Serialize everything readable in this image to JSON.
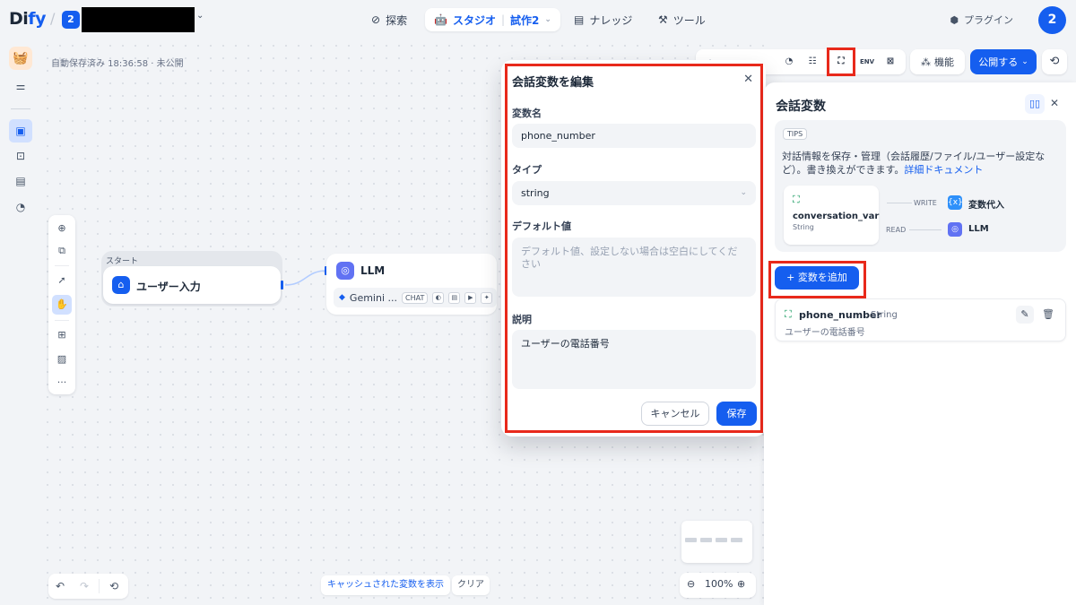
{
  "topbar": {
    "logo_pre": "Di",
    "logo_accent": "fy",
    "workspace_initial": "2",
    "nav": [
      {
        "icon": "compass-icon",
        "label": "探索"
      },
      {
        "icon": "robot-icon",
        "label": "スタジオ",
        "sub": "試作2"
      },
      {
        "icon": "book-icon",
        "label": "ナレッジ"
      },
      {
        "icon": "tools-icon",
        "label": "ツール"
      }
    ],
    "plugin_label": "プラグイン",
    "avatar_initial": "2"
  },
  "canvas": {
    "autosave": "自動保存済み 18:36:58 · 未公開",
    "start_group_label": "スタート",
    "start_node_title": "ユーザー入力",
    "llm_node_title": "LLM",
    "llm_model": "Gemini ...",
    "llm_mode": "CHAT",
    "cache_button": "キャッシュされた変数を表示",
    "clear_button": "クリア",
    "zoom_level": "100%"
  },
  "toolbar": {
    "env_label": "ENV",
    "feature_label": "機能",
    "publish_label": "公開する"
  },
  "modal": {
    "title": "会話変数を編集",
    "name_label": "変数名",
    "name_value": "phone_number",
    "type_label": "タイプ",
    "type_value": "string",
    "default_label": "デフォルト値",
    "default_placeholder": "デフォルト値、設定しない場合は空白にしてください",
    "desc_label": "説明",
    "desc_value": "ユーザーの電話番号",
    "cancel": "キャンセル",
    "save": "保存"
  },
  "panel": {
    "title": "会話変数",
    "tips_badge": "TIPS",
    "tips_text": "対話情報を保存・管理（会話履歴/ファイル/ユーザー設定など）。書き換えができます。",
    "tips_link": "詳細ドキュメント",
    "example_var_name": "conversation_var",
    "example_var_type": "String",
    "write_label": "WRITE",
    "write_target": "変数代入",
    "read_label": "READ",
    "read_target": "LLM",
    "add_button": "+ 変数を追加",
    "variables": [
      {
        "name": "phone_number",
        "type": "String",
        "description": "ユーザーの電話番号"
      }
    ]
  },
  "colors": {
    "accent": "#155eef",
    "highlight": "#e8291b",
    "variable_green": "#079455"
  }
}
